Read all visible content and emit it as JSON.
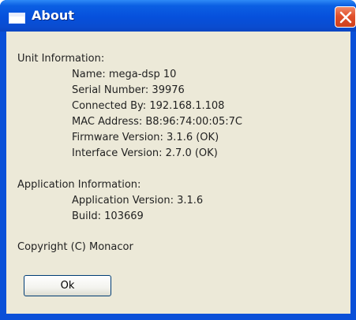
{
  "window": {
    "title": "About",
    "close_icon": "close-x-icon",
    "app_icon": "window-icon",
    "colors": {
      "titlebar": "#0650dc",
      "client": "#ece9d8",
      "close": "#e1502b"
    }
  },
  "unit_info": {
    "heading": "Unit Information:",
    "lines": [
      "Name: mega-dsp 10",
      "Serial Number: 39976",
      "Connected By: 192.168.1.108",
      "MAC Address: B8:96:74:00:05:7C",
      "Firmware Version: 3.1.6 (OK)",
      "Interface Version: 2.7.0 (OK)"
    ]
  },
  "app_info": {
    "heading": "Application Information:",
    "lines": [
      "Application Version: 3.1.6",
      "Build: 103669"
    ]
  },
  "copyright": "Copyright (C) Monacor",
  "buttons": {
    "ok_label": "Ok"
  }
}
